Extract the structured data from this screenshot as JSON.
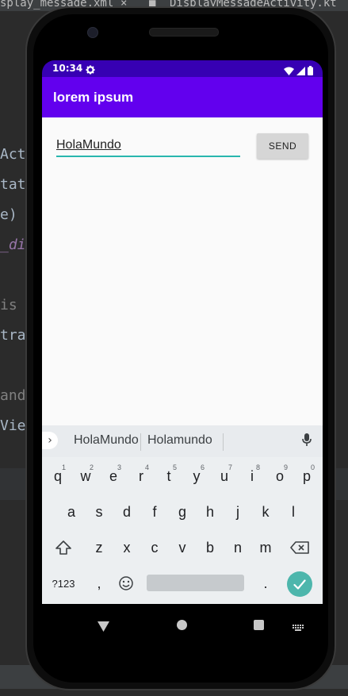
{
  "ide": {
    "tab1": "splay_message.xml",
    "tab_close": "×",
    "tab2": "DisplayMessageActivity.kt",
    "code_lines": [
      "Acti",
      "tate",
      "e)",
      "_dis",
      "is a",
      "tra(",
      "and",
      "View"
    ]
  },
  "status": {
    "time": "10:34",
    "icons": [
      "gear-icon",
      "wifi-icon",
      "signal-icon",
      "battery-icon"
    ]
  },
  "app_bar": {
    "title": "lorem ipsum"
  },
  "form": {
    "message_value": "HolaMundo",
    "send_label": "SEND"
  },
  "keyboard": {
    "suggestions": [
      "HolaMundo",
      "Holamundo"
    ],
    "row1": [
      {
        "key": "q",
        "hint": "1"
      },
      {
        "key": "w",
        "hint": "2"
      },
      {
        "key": "e",
        "hint": "3"
      },
      {
        "key": "r",
        "hint": "4"
      },
      {
        "key": "t",
        "hint": "5"
      },
      {
        "key": "y",
        "hint": "6"
      },
      {
        "key": "u",
        "hint": "7"
      },
      {
        "key": "i",
        "hint": "8"
      },
      {
        "key": "o",
        "hint": "9"
      },
      {
        "key": "p",
        "hint": "0"
      }
    ],
    "row2": [
      "a",
      "s",
      "d",
      "f",
      "g",
      "h",
      "j",
      "k",
      "l"
    ],
    "row3": [
      "z",
      "x",
      "c",
      "v",
      "b",
      "n",
      "m"
    ],
    "symbols_label": "?123",
    "comma": ",",
    "period": "."
  },
  "colors": {
    "status_bar": "#3700b3",
    "app_bar": "#6200ee",
    "accent": "#29b6ae",
    "enter_key": "#4db6ac"
  }
}
